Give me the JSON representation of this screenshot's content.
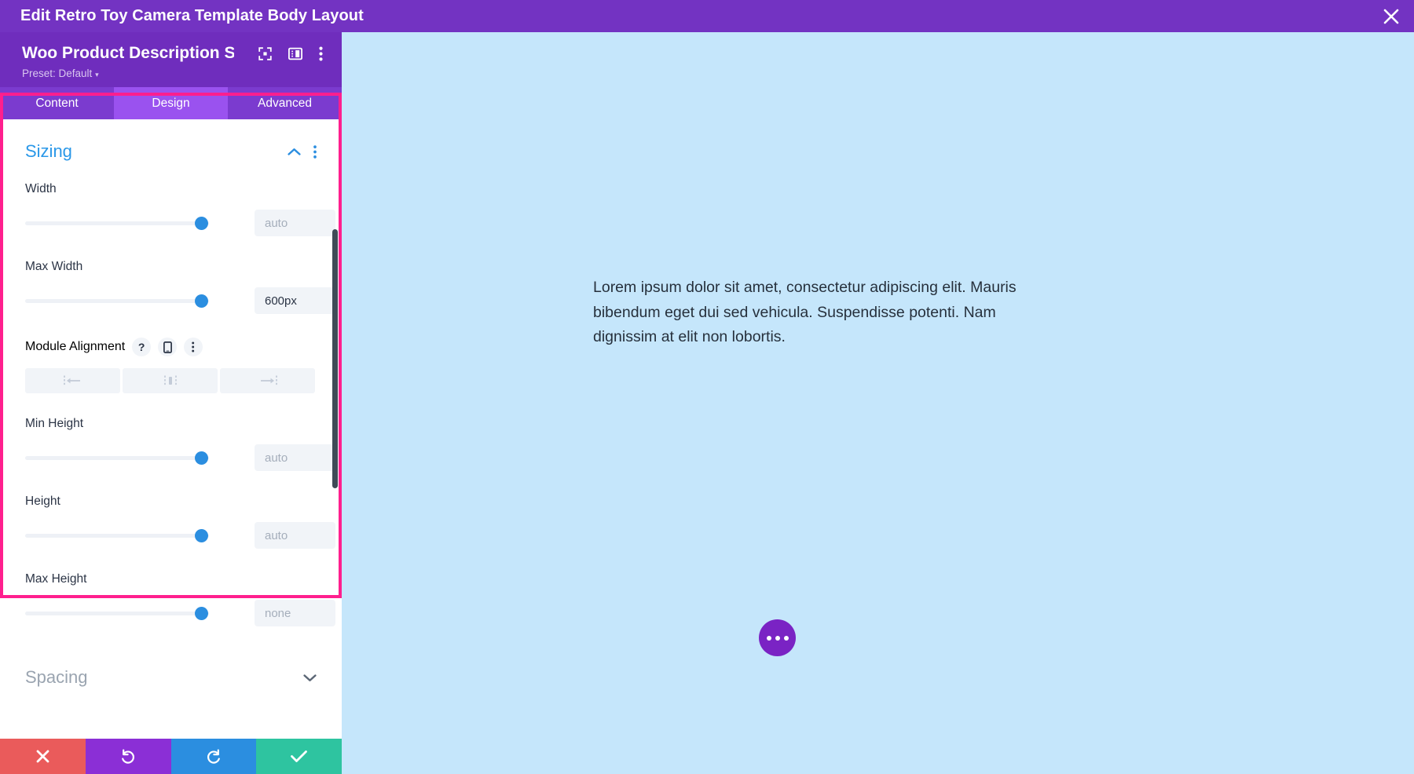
{
  "topbar": {
    "title": "Edit Retro Toy Camera Template Body Layout",
    "close_icon": "close-icon"
  },
  "panel": {
    "module_name": "Woo Product Description S...",
    "preset_label": "Preset: Default",
    "preset_caret": "▾",
    "icons": [
      {
        "name": "focus-target-icon"
      },
      {
        "name": "layout-panel-icon"
      },
      {
        "name": "more-vertical-icon"
      }
    ],
    "tabs": [
      {
        "label": "Content",
        "active": false
      },
      {
        "label": "Design",
        "active": true
      },
      {
        "label": "Advanced",
        "active": false
      }
    ],
    "sections": [
      {
        "title": "Sizing",
        "state": "expanded",
        "collapse_icon": "chevron-up-icon",
        "menu_icon": "more-vertical-icon"
      },
      {
        "title": "Spacing",
        "state": "collapsed",
        "collapse_icon": "chevron-down-icon"
      }
    ],
    "fields": [
      {
        "label": "Width",
        "value": "",
        "placeholder": "auto",
        "slider_percent": 92
      },
      {
        "label": "Max Width",
        "value": "600px",
        "placeholder": "",
        "slider_percent": 92
      },
      {
        "label": "Min Height",
        "value": "",
        "placeholder": "auto",
        "slider_percent": 92
      },
      {
        "label": "Height",
        "value": "",
        "placeholder": "auto",
        "slider_percent": 92
      },
      {
        "label": "Max Height",
        "value": "",
        "placeholder": "none",
        "slider_percent": 92
      }
    ],
    "module_alignment": {
      "label": "Module Alignment",
      "help_icon": "question-mark-icon",
      "responsive_icon": "mobile-phone-icon",
      "menu_icon": "more-vertical-icon",
      "options": [
        {
          "name": "align-left-button",
          "icon": "align-left-icon"
        },
        {
          "name": "align-center-button",
          "icon": "align-center-icon"
        },
        {
          "name": "align-right-button",
          "icon": "align-right-icon"
        }
      ]
    },
    "actions": [
      {
        "name": "cancel-button",
        "icon": "close-x-icon",
        "color": "#ea5b5b"
      },
      {
        "name": "undo-button",
        "icon": "undo-icon",
        "color": "#8b2fd6"
      },
      {
        "name": "redo-button",
        "icon": "redo-icon",
        "color": "#2b8ee0"
      },
      {
        "name": "save-button",
        "icon": "checkmark-icon",
        "color": "#2ec4a0"
      }
    ]
  },
  "preview": {
    "body_text": "Lorem ipsum dolor sit amet, consectetur adipiscing elit. Mauris bibendum eget dui sed vehicula. Suspendisse potenti. Nam dignissim at elit non lobortis.",
    "fab": {
      "name": "page-settings-fab",
      "icon": "ellipsis-icon"
    },
    "background_color": "#c5e6fb"
  },
  "colors": {
    "topbar_purple": "#7333c2",
    "panel_purple": "#6f2dbd",
    "tab_active": "#9a52ef",
    "highlight_pink": "#ff1f8e",
    "section_blue": "#2b98e8",
    "slider_blue": "#2b8ee0"
  }
}
